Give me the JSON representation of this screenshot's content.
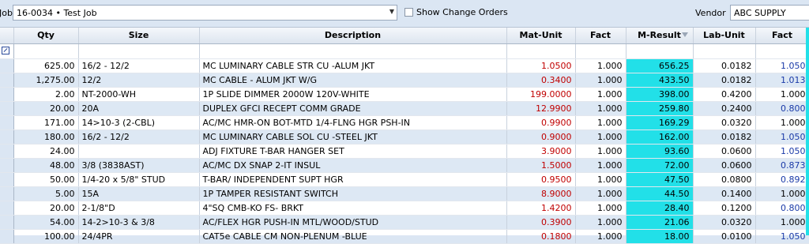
{
  "toolbar": {
    "job_label": "Job",
    "job_value": "16-0034 • Test Job",
    "show_change_orders_label": "Show Change Orders",
    "vendor_label": "Vendor",
    "vendor_value": "ABC SUPPLY"
  },
  "grid": {
    "columns": [
      "Qty",
      "Size",
      "Description",
      "Mat-Unit",
      "Fact",
      "M-Result",
      "Lab-Unit",
      "Fact"
    ],
    "rows": [
      {
        "qty": "625.00",
        "size": "16/2 - 12/2",
        "desc": "MC LUMINARY CABLE STR CU -ALUM JKT",
        "mat": "1.0500",
        "fact": "1.000",
        "mres": "656.25",
        "lab": "0.0182",
        "fact2": "1.050"
      },
      {
        "qty": "1,275.00",
        "size": "12/2",
        "desc": "MC CABLE - ALUM  JKT W/G",
        "mat": "0.3400",
        "fact": "1.000",
        "mres": "433.50",
        "lab": "0.0182",
        "fact2": "1.013"
      },
      {
        "qty": "2.00",
        "size": "NT-2000-WH",
        "desc": "1P SLIDE DIMMER 2000W 120V-WHITE",
        "mat": "199.0000",
        "fact": "1.000",
        "mres": "398.00",
        "lab": "0.4200",
        "fact2": "1.000"
      },
      {
        "qty": "20.00",
        "size": "20A",
        "desc": "DUPLEX GFCI RECEPT COMM GRADE",
        "mat": "12.9900",
        "fact": "1.000",
        "mres": "259.80",
        "lab": "0.2400",
        "fact2": "0.800"
      },
      {
        "qty": "171.00",
        "size": "14>10-3 (2-CBL)",
        "desc": "AC/MC HMR-ON BOT-MTD 1/4-FLNG HGR PSH-IN",
        "mat": "0.9900",
        "fact": "1.000",
        "mres": "169.29",
        "lab": "0.0320",
        "fact2": "1.000"
      },
      {
        "qty": "180.00",
        "size": "16/2 - 12/2",
        "desc": "MC LUMINARY CABLE SOL CU -STEEL JKT",
        "mat": "0.9000",
        "fact": "1.000",
        "mres": "162.00",
        "lab": "0.0182",
        "fact2": "1.050"
      },
      {
        "qty": "24.00",
        "size": "",
        "desc": "ADJ FIXTURE T-BAR HANGER SET",
        "mat": "3.9000",
        "fact": "1.000",
        "mres": "93.60",
        "lab": "0.0600",
        "fact2": "1.050"
      },
      {
        "qty": "48.00",
        "size": "3/8  (3838AST)",
        "desc": "AC/MC DX SNAP 2-IT INSUL",
        "mat": "1.5000",
        "fact": "1.000",
        "mres": "72.00",
        "lab": "0.0600",
        "fact2": "0.873"
      },
      {
        "qty": "50.00",
        "size": "1/4-20 x 5/8\" STUD",
        "desc": "T-BAR/ INDEPENDENT SUPT HGR",
        "mat": "0.9500",
        "fact": "1.000",
        "mres": "47.50",
        "lab": "0.0800",
        "fact2": "0.892"
      },
      {
        "qty": "5.00",
        "size": "15A",
        "desc": "1P  TAMPER RESISTANT SWITCH",
        "mat": "8.9000",
        "fact": "1.000",
        "mres": "44.50",
        "lab": "0.1400",
        "fact2": "1.000"
      },
      {
        "qty": "20.00",
        "size": "2-1/8\"D",
        "desc": "4\"SQ  CMB-KO  FS- BRKT",
        "mat": "1.4200",
        "fact": "1.000",
        "mres": "28.40",
        "lab": "0.1200",
        "fact2": "0.800"
      },
      {
        "qty": "54.00",
        "size": "14-2>10-3 & 3/8",
        "desc": "AC/FLEX HGR PUSH-IN MTL/WOOD/STUD",
        "mat": "0.3900",
        "fact": "1.000",
        "mres": "21.06",
        "lab": "0.0320",
        "fact2": "1.000"
      },
      {
        "qty": "100.00",
        "size": "24/4PR",
        "desc": "CAT5e CABLE CM NON-PLENUM -BLUE",
        "mat": "0.1800",
        "fact": "1.000",
        "mres": "18.00",
        "lab": "0.0100",
        "fact2": "1.050"
      }
    ],
    "colors": {
      "mat_unit": "#c00000",
      "m_result_bg": "#22e0e8",
      "lab_fact": "#1a3aa8"
    }
  }
}
